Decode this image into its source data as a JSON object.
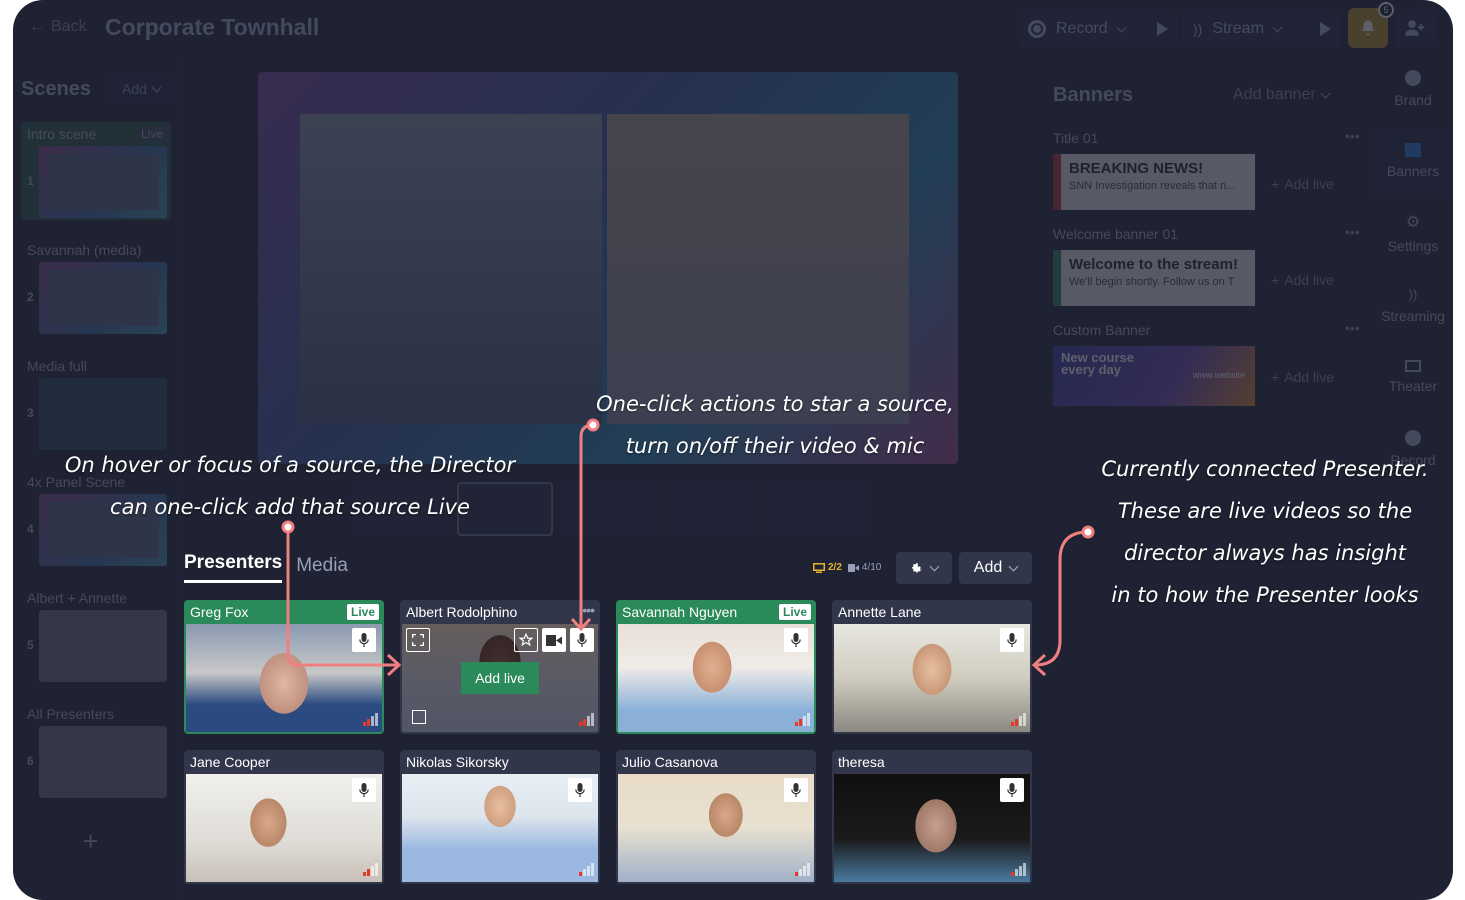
{
  "topbar": {
    "back_label": "Back",
    "title": "Corporate Townhall",
    "record_label": "Record",
    "stream_label": "Stream",
    "notifications_count": "5"
  },
  "scenes": {
    "heading": "Scenes",
    "add_label": "Add",
    "live_badge": "Live",
    "items": [
      {
        "name": "Intro scene",
        "number": "1",
        "live": true
      },
      {
        "name": "Savannah (media)",
        "number": "2"
      },
      {
        "name": "Media full",
        "number": "3"
      },
      {
        "name": "4x Panel Scene",
        "number": "4"
      },
      {
        "name": "Albert + Annette",
        "number": "5"
      },
      {
        "name": "All Presenters",
        "number": "6"
      }
    ],
    "add_scene_icon": "+"
  },
  "banners": {
    "heading": "Banners",
    "add_label": "Add banner",
    "add_live_label": "Add live",
    "items": [
      {
        "label": "Title 01",
        "headline": "BREAKING NEWS!",
        "subline": "SNN Investigation reveals that n...",
        "accent": "#b03030"
      },
      {
        "label": "Welcome banner 01",
        "headline": "Welcome to the stream!",
        "subline": "We'll begin shortly.  Follow us on T",
        "accent": "#2a8a5a"
      },
      {
        "label": "Custom Banner",
        "headline": "New course every day",
        "subline": "www.website"
      }
    ]
  },
  "right_nav": [
    {
      "label": "Brand",
      "icon": "palette-icon"
    },
    {
      "label": "Banners",
      "icon": "banners-icon",
      "active": true
    },
    {
      "label": "Settings",
      "icon": "gear-icon"
    },
    {
      "label": "Streaming",
      "icon": "rss-icon"
    },
    {
      "label": "Theater",
      "icon": "film-icon"
    },
    {
      "label": "Record",
      "icon": "record-icon"
    }
  ],
  "sources": {
    "tabs": [
      {
        "label": "Presenters",
        "active": true
      },
      {
        "label": "Media",
        "active": false
      }
    ],
    "screen_count": "2/2",
    "camera_count": "4/10",
    "add_label": "Add",
    "live_badge": "Live",
    "add_live_label": "Add live",
    "presenters": [
      {
        "name": "Greg Fox",
        "live": true,
        "signal": 2
      },
      {
        "name": "Albert Rodolphino",
        "live": false,
        "hovered": true,
        "signal": 2
      },
      {
        "name": "Savannah Nguyen",
        "live": true,
        "signal": 2
      },
      {
        "name": "Annette Lane",
        "live": false,
        "signal": 2
      },
      {
        "name": "Jane Cooper",
        "live": false,
        "signal": 2
      },
      {
        "name": "Nikolas Sikorsky",
        "live": false,
        "signal": 1
      },
      {
        "name": "Julio Casanova",
        "live": false,
        "signal": 1
      },
      {
        "name": "theresa",
        "live": false,
        "signal": 1
      }
    ]
  },
  "annotations": {
    "hover_note": [
      "On hover or focus of a source, the Director",
      "can one-click add that source Live"
    ],
    "actions_note": [
      "One-click actions to star a source,",
      "turn on/off their video & mic"
    ],
    "presenter_note": [
      "Currently connected Presenter.",
      "These are live videos so the",
      "director always has insight",
      "in to how the Presenter looks"
    ]
  },
  "colors": {
    "background": "#1f2232",
    "live_green": "#2a8a5a",
    "accent_yellow": "#e3b52a",
    "annotation_pink": "#f08080"
  }
}
